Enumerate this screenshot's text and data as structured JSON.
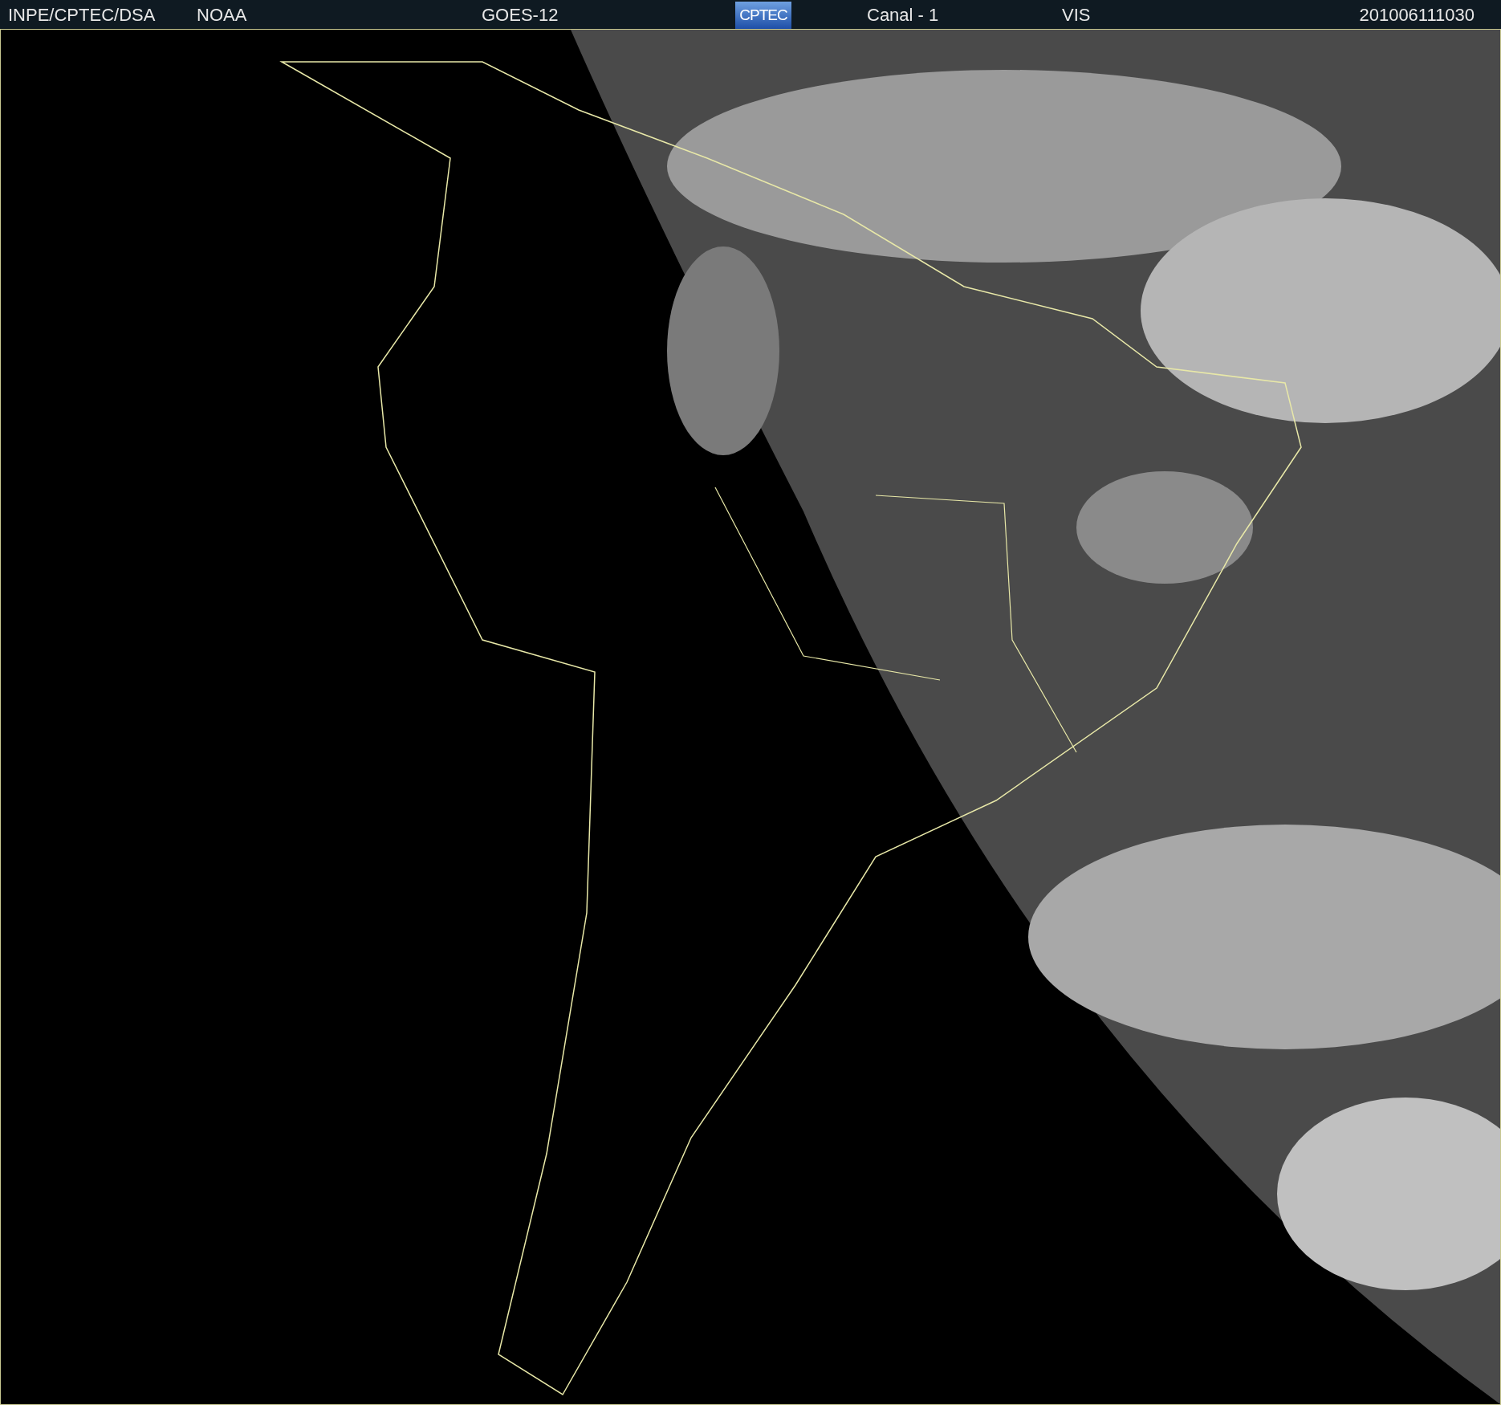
{
  "header": {
    "source": "INPE/CPTEC/DSA",
    "agency": "NOAA",
    "satellite": "GOES-12",
    "logo": "CPTEC",
    "channel": "Canal - 1",
    "band": "VIS",
    "timestamp": "201006111030"
  }
}
